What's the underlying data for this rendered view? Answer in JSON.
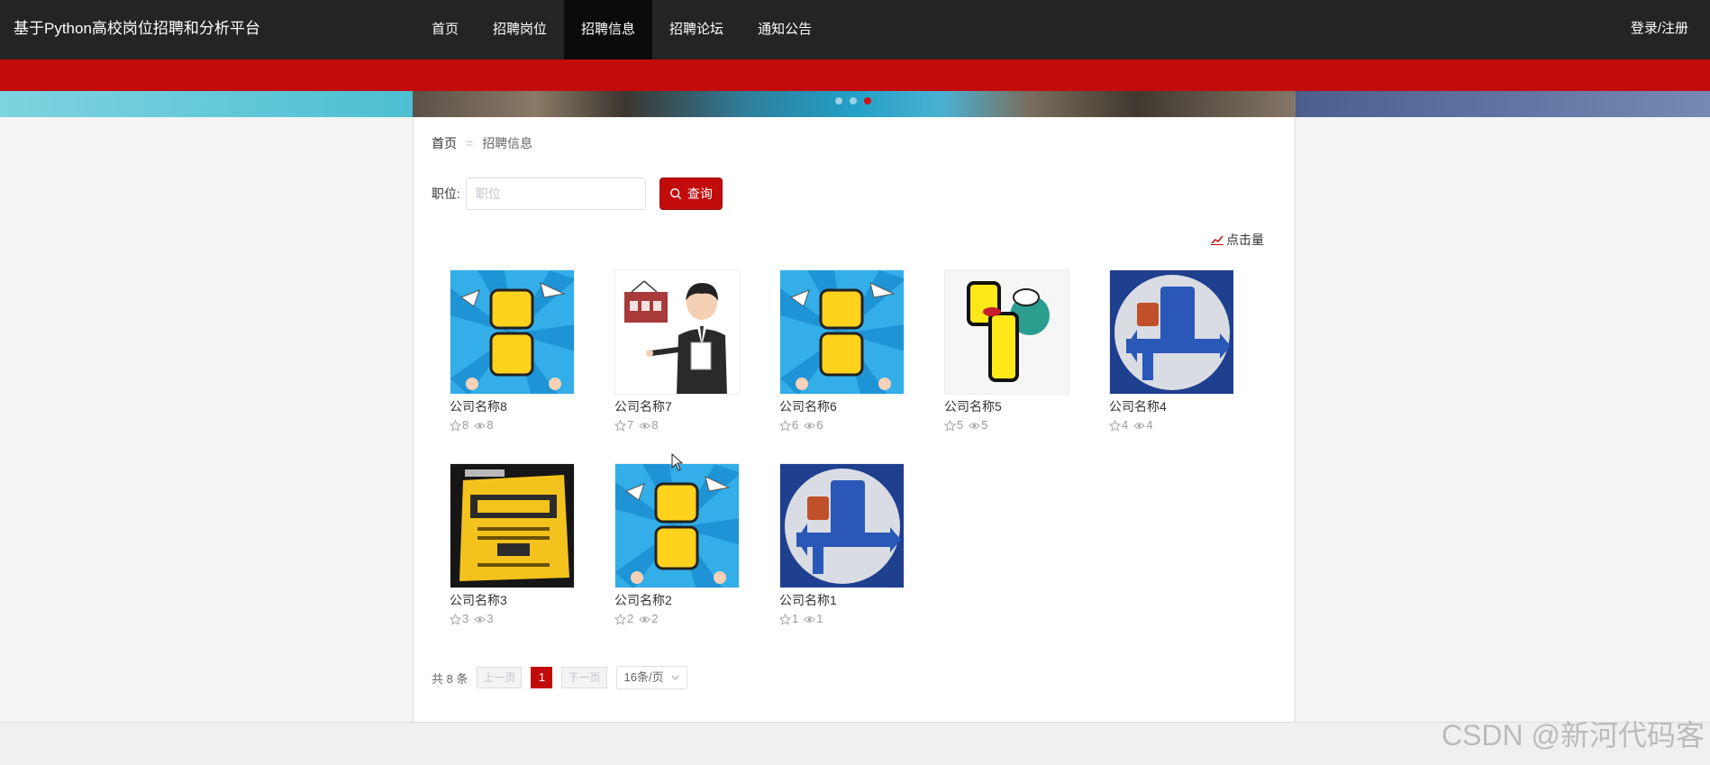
{
  "header": {
    "brand": "基于Python高校岗位招聘和分析平台",
    "nav": [
      {
        "label": "首页",
        "active": false
      },
      {
        "label": "招聘岗位",
        "active": false
      },
      {
        "label": "招聘信息",
        "active": true
      },
      {
        "label": "招聘论坛",
        "active": false
      },
      {
        "label": "通知公告",
        "active": false
      }
    ],
    "login": "登录/注册"
  },
  "breadcrumb": {
    "home": "首页",
    "separator": "=",
    "current": "招聘信息"
  },
  "search": {
    "label": "职位:",
    "placeholder": "职位",
    "value": "",
    "button": "查询"
  },
  "sort_label": "点击量",
  "cards": [
    {
      "name": "公司名称8",
      "stars": "8",
      "views": "8",
      "image": "zhaopin-burst"
    },
    {
      "name": "公司名称7",
      "stars": "7",
      "views": "8",
      "image": "hiring-man"
    },
    {
      "name": "公司名称6",
      "stars": "6",
      "views": "6",
      "image": "zhaopin-burst"
    },
    {
      "name": "公司名称5",
      "stars": "5",
      "views": "5",
      "image": "zhaopin-sign"
    },
    {
      "name": "公司名称4",
      "stars": "4",
      "views": "4",
      "image": "pin-circle"
    },
    {
      "name": "公司名称3",
      "stars": "3",
      "views": "3",
      "image": "zhaomuling-poster"
    },
    {
      "name": "公司名称2",
      "stars": "2",
      "views": "2",
      "image": "zhaopin-burst"
    },
    {
      "name": "公司名称1",
      "stars": "1",
      "views": "1",
      "image": "pin-circle"
    }
  ],
  "pagination": {
    "total": "共 8 条",
    "prev": "上一页",
    "current": "1",
    "next": "下一页",
    "page_size": "16条/页"
  },
  "watermark": "CSDN @新河代码客",
  "colors": {
    "accent": "#c20c0c",
    "topbar": "#242424"
  }
}
